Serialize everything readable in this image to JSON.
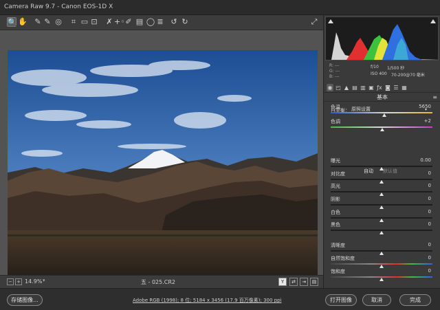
{
  "titlebar": {
    "title": "Camera Raw 9.7  -  Canon EOS-1D X"
  },
  "toolbar": {
    "tools": [
      {
        "icon": "zoom-icon",
        "glyph": "🔍"
      },
      {
        "icon": "hand-icon",
        "glyph": "✋"
      },
      {
        "icon": "white-balance-icon",
        "glyph": "✎"
      },
      {
        "icon": "color-sampler-icon",
        "glyph": "✎"
      },
      {
        "icon": "targeted-adjust-icon",
        "glyph": "◎"
      },
      {
        "icon": "crop-icon",
        "glyph": "⌗"
      },
      {
        "icon": "straighten-icon",
        "glyph": "▭"
      },
      {
        "icon": "transform-icon",
        "glyph": "⊡"
      },
      {
        "icon": "spot-removal-icon",
        "glyph": "✗"
      },
      {
        "icon": "red-eye-icon",
        "glyph": "+◦"
      },
      {
        "icon": "adjustment-brush-icon",
        "glyph": "✐"
      },
      {
        "icon": "graduated-filter-icon",
        "glyph": "▤"
      },
      {
        "icon": "radial-filter-icon",
        "glyph": "◯"
      },
      {
        "icon": "preferences-icon",
        "glyph": "≣"
      },
      {
        "icon": "rotate-left-icon",
        "glyph": "↺"
      },
      {
        "icon": "rotate-right-icon",
        "glyph": "↻"
      }
    ],
    "fullscreen_icon": "fullscreen-icon"
  },
  "bottombar": {
    "zoom_out": "−",
    "zoom_in": "+",
    "zoom": "14.9%",
    "filename": "五 - 025.CR2",
    "view_y": "Y"
  },
  "panel": {
    "exif": {
      "r": "R:  ---",
      "g": "G:  ---",
      "b": "B:  ---",
      "aperture": "f/10",
      "shutter": "1/500 秒",
      "iso": "ISO 400",
      "lens": "70-200@70 毫米"
    },
    "section_title": "基本",
    "wb_label": "白平衡：",
    "wb_value": "原照设置",
    "auto": "自动",
    "default": "默认值",
    "sliders": [
      {
        "label": "色温",
        "value": "5650",
        "pos": 0.53
      },
      {
        "label": "色调",
        "value": "+2",
        "pos": 0.51
      },
      {
        "label": "曝光",
        "value": "0.00",
        "pos": 0.5
      },
      {
        "label": "对比度",
        "value": "0",
        "pos": 0.5
      },
      {
        "label": "高光",
        "value": "0",
        "pos": 0.5
      },
      {
        "label": "阴影",
        "value": "0",
        "pos": 0.5
      },
      {
        "label": "白色",
        "value": "0",
        "pos": 0.5
      },
      {
        "label": "黑色",
        "value": "0",
        "pos": 0.5
      },
      {
        "label": "清晰度",
        "value": "0",
        "pos": 0.5
      },
      {
        "label": "自然饱和度",
        "value": "0",
        "pos": 0.5
      },
      {
        "label": "饱和度",
        "value": "0",
        "pos": 0.5
      }
    ]
  },
  "footer": {
    "save": "存储图像...",
    "workflow": "Adobe RGB (1998); 8 位; 5184 x 3456 (17.9 百万像素); 300 ppi",
    "open": "打开图像",
    "cancel": "取消",
    "done": "完成"
  },
  "colors": {
    "accent": "#e6e6e6",
    "sky_top": "#1f4f95",
    "sky_bottom": "#7ea8d8"
  }
}
